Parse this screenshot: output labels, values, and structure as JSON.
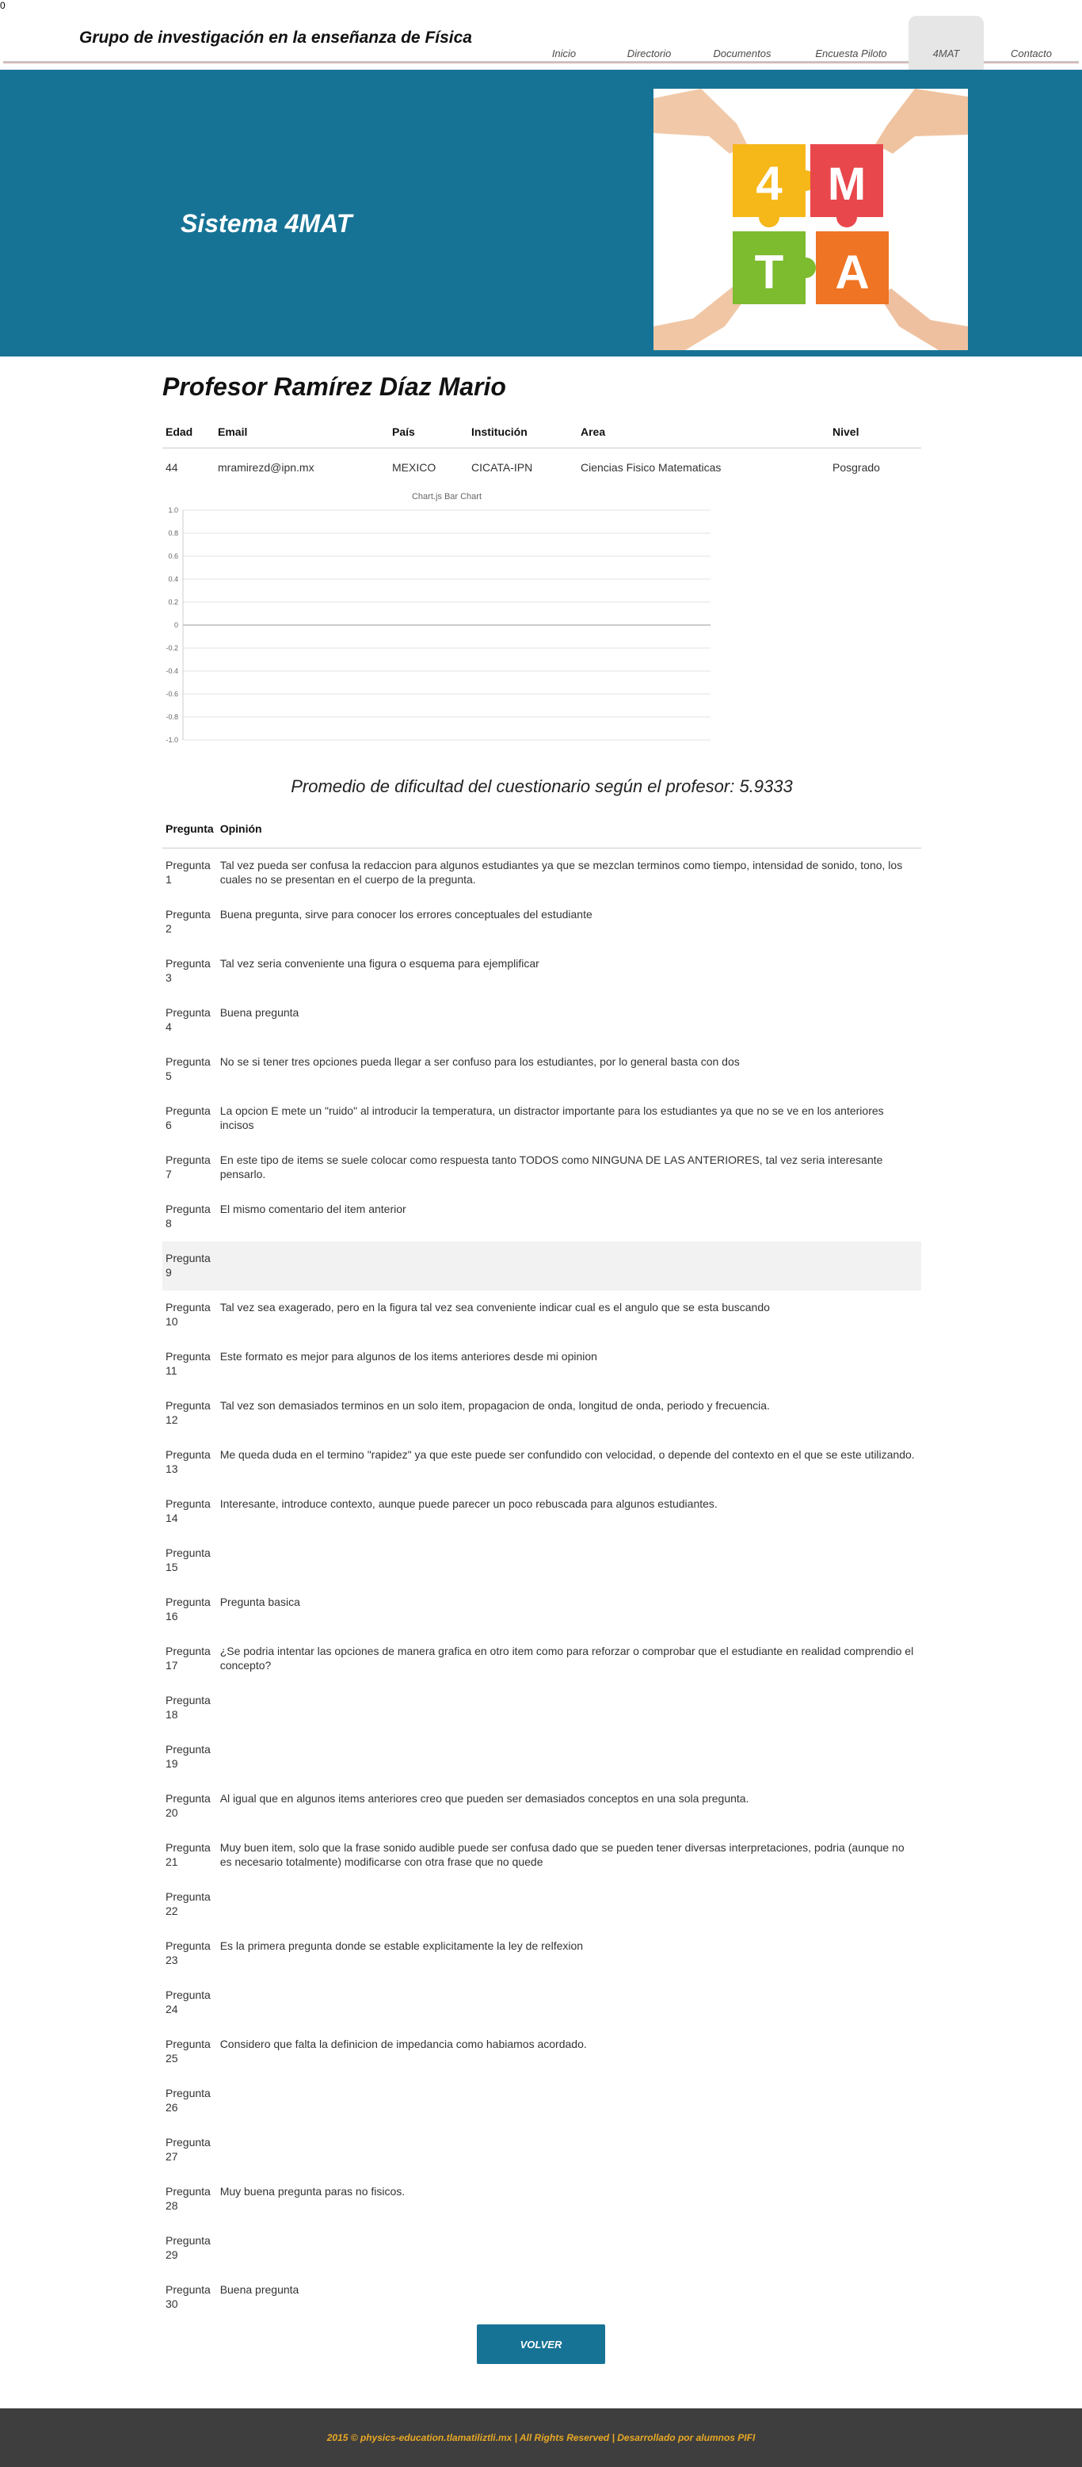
{
  "stray_char": "0",
  "header": {
    "title": "Grupo de investigación en la enseñanza de Física",
    "nav": [
      {
        "label": "Inicio"
      },
      {
        "label": "Directorio"
      },
      {
        "label": "Documentos"
      },
      {
        "label": "Encuesta Piloto"
      },
      {
        "label": "4MAT",
        "active": true
      },
      {
        "label": "Contacto"
      }
    ]
  },
  "banner": {
    "title": "Sistema 4MAT",
    "puzzle_letters": [
      "4",
      "M",
      "T",
      "A"
    ],
    "colors": {
      "bg": "#177395",
      "yellow": "#f6b719",
      "red": "#e8474c",
      "green": "#7dbb2f",
      "orange": "#ef7424"
    }
  },
  "profile": {
    "name": "Profesor Ramírez Díaz Mario",
    "headers": [
      "Edad",
      "Email",
      "País",
      "Institución",
      "Area",
      "Nivel"
    ],
    "values": [
      "44",
      "mramirezd@ipn.mx",
      "MEXICO",
      "CICATA-IPN",
      "Ciencias Fisico Matematicas",
      "Posgrado"
    ]
  },
  "chart_data": {
    "type": "bar",
    "title": "Chart.js Bar Chart",
    "categories": [],
    "series": [],
    "ylim": [
      -1.0,
      1.0
    ],
    "yticks": [
      "1.0",
      "0.8",
      "0.6",
      "0.4",
      "0.2",
      "0",
      "-0.2",
      "-0.4",
      "-0.6",
      "-0.8",
      "-1.0"
    ],
    "grid": true
  },
  "average": {
    "text": "Promedio de dificultad del cuestionario según el profesor: 5.9333"
  },
  "opinions": {
    "headers": [
      "Pregunta",
      "Opinión"
    ],
    "rows": [
      {
        "q": "Pregunta 1",
        "text": "Tal vez pueda ser confusa la redaccion para algunos estudiantes ya que se mezclan terminos como tiempo, intensidad de sonido, tono, los cuales no se presentan en el cuerpo de la pregunta."
      },
      {
        "q": "Pregunta 2",
        "text": "Buena pregunta, sirve para conocer los errores conceptuales del estudiante"
      },
      {
        "q": "Pregunta 3",
        "text": "Tal vez seria conveniente una figura o esquema para ejemplificar"
      },
      {
        "q": "Pregunta 4",
        "text": "Buena pregunta"
      },
      {
        "q": "Pregunta 5",
        "text": "No se si tener tres opciones pueda llegar a ser confuso para los estudiantes, por lo general basta con dos"
      },
      {
        "q": "Pregunta 6",
        "text": "La opcion E mete un \"ruido\" al introducir la temperatura, un distractor importante para los estudiantes ya que no se ve en los anteriores incisos"
      },
      {
        "q": "Pregunta 7",
        "text": "En este tipo de items se suele colocar como respuesta tanto TODOS como NINGUNA DE LAS ANTERIORES, tal vez seria interesante pensarlo."
      },
      {
        "q": "Pregunta 8",
        "text": "El mismo comentario del item anterior"
      },
      {
        "q": "Pregunta 9",
        "text": "",
        "highlight": true
      },
      {
        "q": "Pregunta 10",
        "text": "Tal vez sea exagerado, pero en la figura tal vez sea conveniente indicar cual es el angulo que se esta buscando"
      },
      {
        "q": "Pregunta 11",
        "text": "Este formato es mejor para algunos de los items anteriores desde mi opinion"
      },
      {
        "q": "Pregunta 12",
        "text": "Tal vez son demasiados terminos en un solo item, propagacion de onda, longitud de onda, periodo y frecuencia."
      },
      {
        "q": "Pregunta 13",
        "text": "Me queda duda en el termino \"rapidez\" ya que este puede ser confundido con velocidad, o depende del contexto en el que se este utilizando."
      },
      {
        "q": "Pregunta 14",
        "text": "Interesante, introduce contexto, aunque puede parecer un poco rebuscada para algunos estudiantes."
      },
      {
        "q": "Pregunta 15",
        "text": ""
      },
      {
        "q": "Pregunta 16",
        "text": "Pregunta basica"
      },
      {
        "q": "Pregunta 17",
        "text": "¿Se podria intentar las opciones de manera grafica en otro item como para reforzar o comprobar que el estudiante en realidad comprendio el concepto?"
      },
      {
        "q": "Pregunta 18",
        "text": ""
      },
      {
        "q": "Pregunta 19",
        "text": ""
      },
      {
        "q": "Pregunta 20",
        "text": "Al igual que en algunos items anteriores creo que pueden ser demasiados conceptos en una sola pregunta."
      },
      {
        "q": "Pregunta 21",
        "text": "Muy buen item, solo que la frase sonido audible puede ser confusa dado que se pueden tener diversas interpretaciones, podria (aunque no es necesario totalmente) modificarse con otra frase que no quede"
      },
      {
        "q": "Pregunta 22",
        "text": ""
      },
      {
        "q": "Pregunta 23",
        "text": "Es la primera pregunta donde se estable explicitamente la ley de relfexion"
      },
      {
        "q": "Pregunta 24",
        "text": ""
      },
      {
        "q": "Pregunta 25",
        "text": "Considero que falta la definicion de impedancia como habiamos acordado."
      },
      {
        "q": "Pregunta 26",
        "text": ""
      },
      {
        "q": "Pregunta 27",
        "text": ""
      },
      {
        "q": "Pregunta 28",
        "text": "Muy buena pregunta paras no fisicos."
      },
      {
        "q": "Pregunta 29",
        "text": ""
      },
      {
        "q": "Pregunta 30",
        "text": "Buena pregunta"
      }
    ]
  },
  "back_button": {
    "label": "VOLVER"
  },
  "footer": {
    "text": "2015 © physics-education.tlamatiliztli.mx | All Rights Reserved | Desarrollado por alumnos PIFI"
  }
}
